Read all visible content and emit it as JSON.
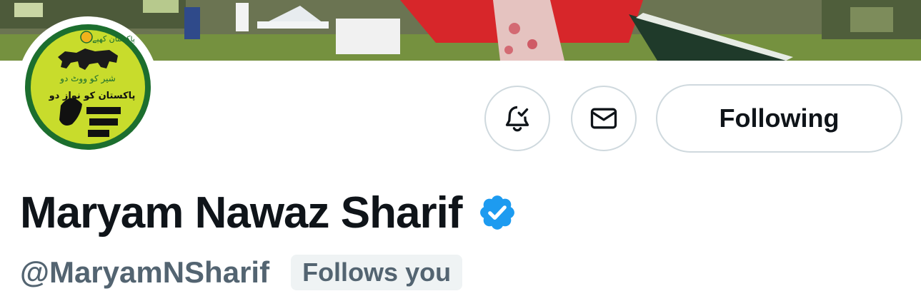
{
  "profile": {
    "display_name": "Maryam Nawaz Sharif",
    "handle": "@MaryamNSharif",
    "follows_you_badge": "Follows you",
    "verified": true
  },
  "actions": {
    "notifications_icon": "bell-check-icon",
    "message_icon": "envelope-icon",
    "follow_label": "Following"
  },
  "avatar": {
    "text_top": "پاکستان کھپے",
    "text_slogan": "شیر کو ووٹ دو",
    "text_main": "پاکستان کو نواز دو",
    "colors": {
      "fill": "#c8dc2c",
      "ring": "#1c6e2e"
    }
  },
  "colors": {
    "verified_blue": "#1d9bf0",
    "text_primary": "#0f1419",
    "text_secondary": "#536471",
    "border": "#cfd9de",
    "badge_bg": "#eff3f4"
  }
}
